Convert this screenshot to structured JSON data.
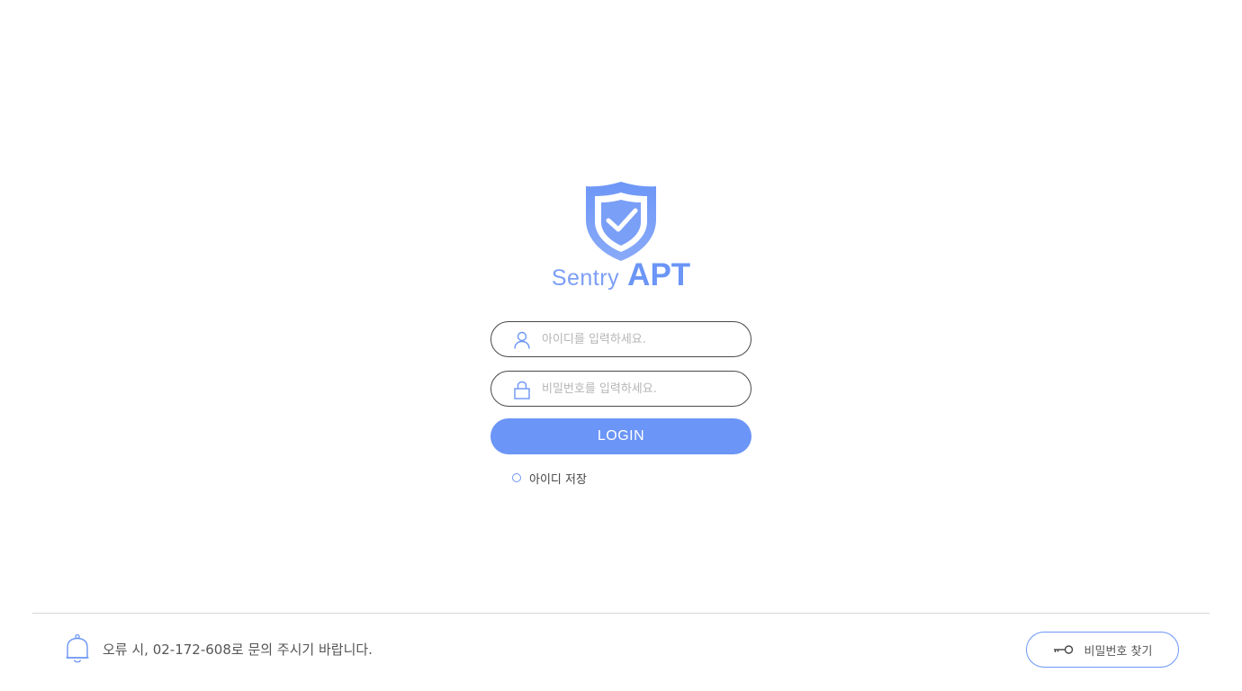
{
  "brand": {
    "name": "Sentry",
    "product": "APT",
    "logo_icon": "shield-check-icon"
  },
  "login_form": {
    "id_placeholder": "아이디를 입력하세요.",
    "id_value": "",
    "id_icon": "user-icon",
    "password_placeholder": "비밀번호를 입력하세요.",
    "password_value": "",
    "password_icon": "lock-icon",
    "login_label": "LOGIN",
    "remember_label": "아이디 저장",
    "remember_checked": false
  },
  "footer": {
    "notice_icon": "bell-icon",
    "notice_text": "오류 시, 02-172-608로 문의 주시기 바랍니다.",
    "find_password_icon": "key-icon",
    "find_password_label": "비밀번호 찾기"
  },
  "colors": {
    "accent": "#6b95f6",
    "text_muted": "#b5b5b5",
    "field_border": "#4a4a4a"
  }
}
